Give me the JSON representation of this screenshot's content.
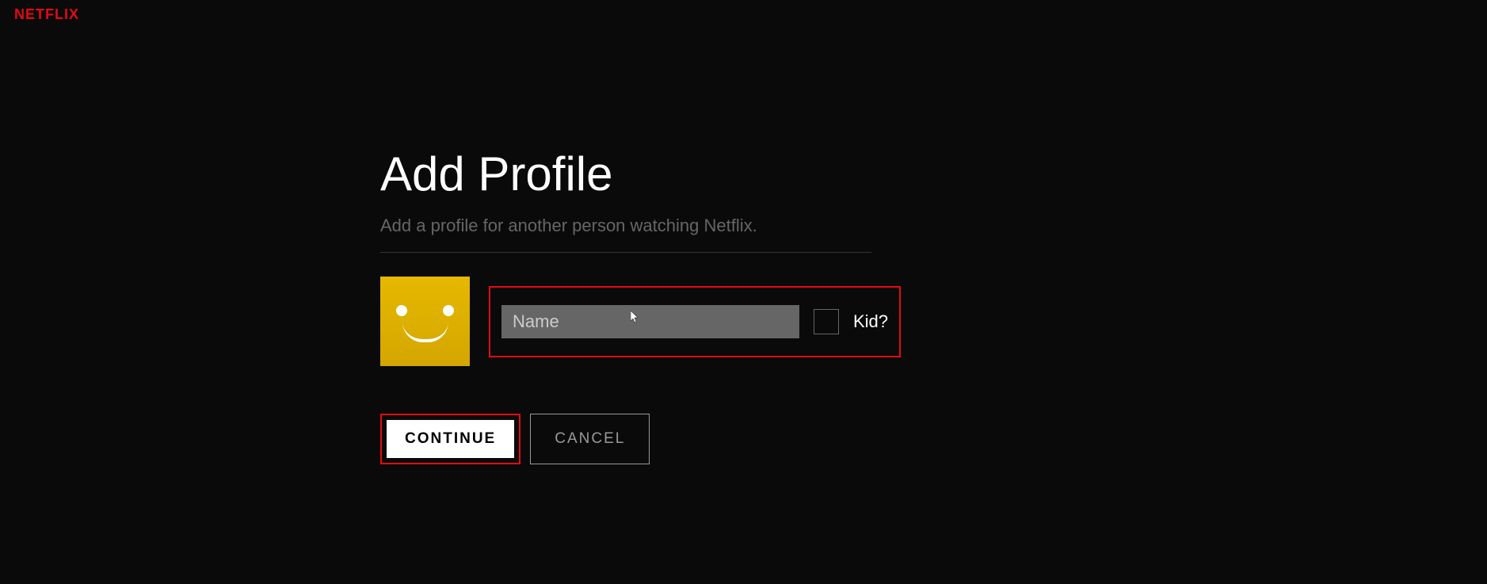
{
  "brand": "NETFLIX",
  "main": {
    "title": "Add Profile",
    "subtitle": "Add a profile for another person watching Netflix."
  },
  "form": {
    "name_placeholder": "Name",
    "name_value": "",
    "kid_label": "Kid?"
  },
  "actions": {
    "continue_label": "CONTINUE",
    "cancel_label": "CANCEL"
  },
  "avatar": {
    "icon_name": "smiley-icon",
    "color": "#e6b800"
  },
  "highlights": {
    "color": "#e50914"
  }
}
